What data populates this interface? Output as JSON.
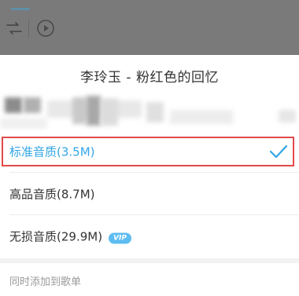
{
  "sheet": {
    "title": "李玲玉 - 粉红色的回忆"
  },
  "quality_options": [
    {
      "label": "标准音质(3.5M)",
      "selected": true
    },
    {
      "label": "高品音质(8.7M)",
      "selected": false
    },
    {
      "label": "无损音质(29.9M)",
      "selected": false,
      "badge": "VIP"
    }
  ],
  "footer": {
    "add_to_playlist_label": "同时添加到歌单"
  },
  "colors": {
    "accent": "#31a5e4",
    "highlight_border": "#e24a4a",
    "vip_badge": "#5dbcf0",
    "overlay": "#7b7b7b"
  },
  "icons": {
    "shuffle": "shuffle-icon",
    "play": "play-circle-icon",
    "check": "check-icon"
  }
}
